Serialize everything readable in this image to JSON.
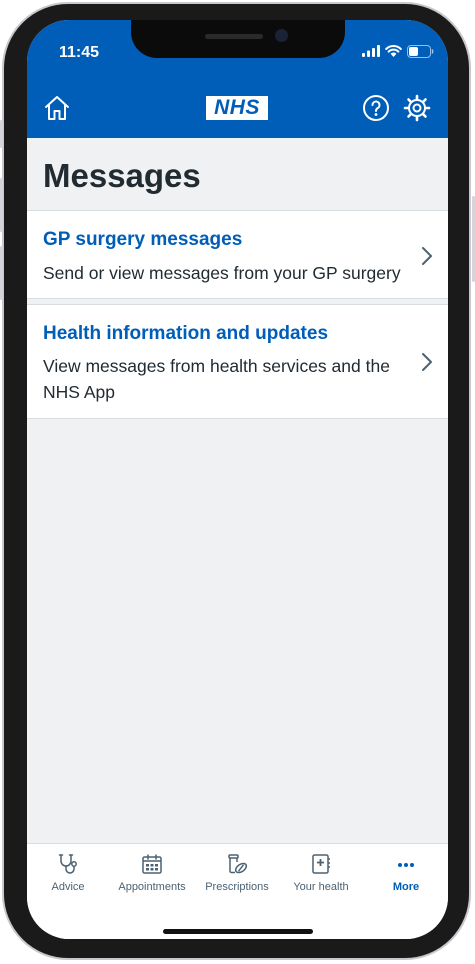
{
  "status_bar": {
    "time": "11:45",
    "icons": [
      "signal-icon",
      "wifi-icon",
      "battery-icon"
    ]
  },
  "header": {
    "logo_text": "NHS",
    "home_icon": "home-icon",
    "help_icon": "help-icon",
    "settings_icon": "gear-icon"
  },
  "page": {
    "title": "Messages"
  },
  "cards": [
    {
      "title": "GP surgery messages",
      "description": "Send or view messages from your GP surgery"
    },
    {
      "title": "Health information and updates",
      "description": "View messages from health services and the NHS App"
    }
  ],
  "tabs": [
    {
      "label": "Advice",
      "icon": "stethoscope-icon",
      "active": false
    },
    {
      "label": "Appointments",
      "icon": "calendar-icon",
      "active": false
    },
    {
      "label": "Prescriptions",
      "icon": "pills-icon",
      "active": false
    },
    {
      "label": "Your health",
      "icon": "health-record-icon",
      "active": false
    },
    {
      "label": "More",
      "icon": "more-icon",
      "active": true
    }
  ],
  "colors": {
    "brand_blue": "#005eb8",
    "background": "#eff1f2",
    "text_dark": "#212b32",
    "tab_text": "#4c6272"
  }
}
